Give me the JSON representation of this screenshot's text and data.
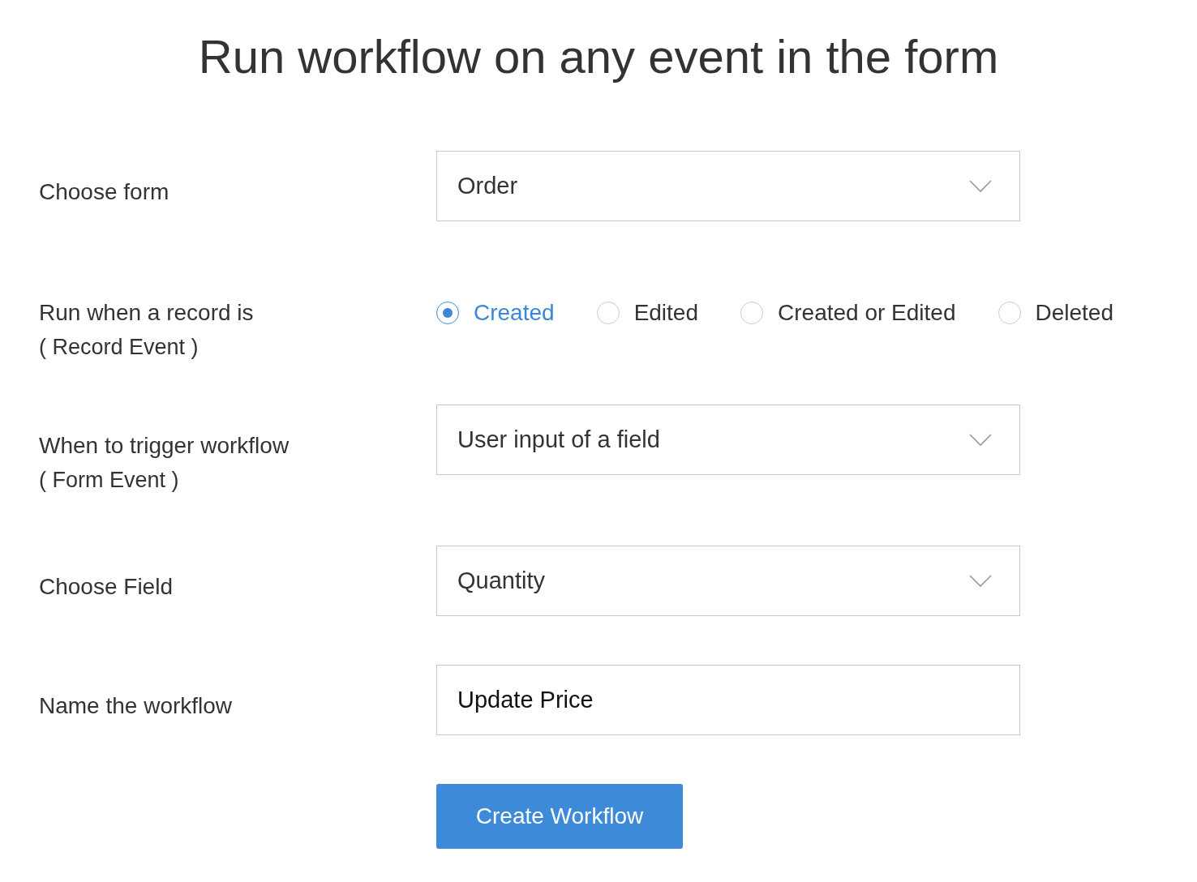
{
  "title": "Run workflow on any event in the form",
  "rows": [
    {
      "kind": "select",
      "label": "Choose form",
      "value": "Order"
    },
    {
      "kind": "radio",
      "label": "Run when a record is",
      "sublabel": "( Record Event )",
      "options": [
        {
          "label": "Created",
          "selected": true
        },
        {
          "label": "Edited",
          "selected": false
        },
        {
          "label": "Created or Edited",
          "selected": false
        },
        {
          "label": "Deleted",
          "selected": false
        }
      ]
    },
    {
      "kind": "select",
      "label": "When to trigger workflow",
      "sublabel": "( Form Event )",
      "value": "User input of a field"
    },
    {
      "kind": "select",
      "label": "Choose Field",
      "value": "Quantity"
    },
    {
      "kind": "text",
      "label": "Name the workflow",
      "value": "Update Price"
    }
  ],
  "button": "Create Workflow"
}
